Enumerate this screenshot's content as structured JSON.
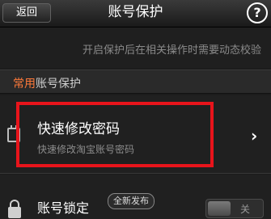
{
  "header": {
    "back_label": "返回",
    "title": "账号保护",
    "help_label": "?"
  },
  "notice": "开启保护后在相关操作时需要动态校验",
  "section": {
    "accent": "常用",
    "rest": "账号保护"
  },
  "quick_change": {
    "title": "快速修改密码",
    "subtitle": "快速修改淘宝账号密码",
    "chevron": "›"
  },
  "account_lock": {
    "title": "账号锁定",
    "badge": "全新发布",
    "toggle_label": "关",
    "enabled": false
  },
  "colors": {
    "accent": "#ff7a3a",
    "highlight": "#e8141b"
  }
}
